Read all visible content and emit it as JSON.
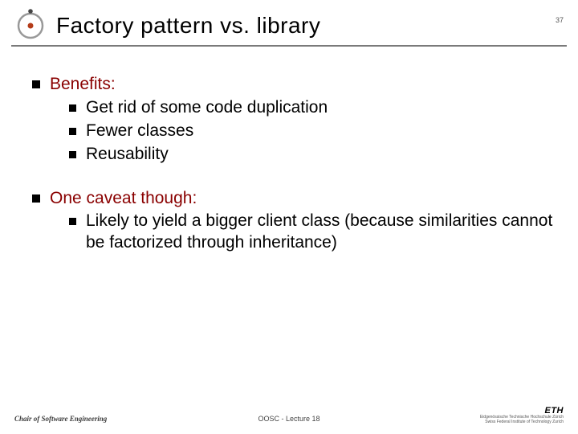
{
  "header": {
    "title": "Factory pattern vs. library",
    "page_number": "37"
  },
  "content": {
    "groups": [
      {
        "head": "Benefits:",
        "items": [
          "Get rid of some code duplication",
          "Fewer classes",
          "Reusability"
        ]
      },
      {
        "head": "One caveat though:",
        "items": [
          "Likely to yield a bigger client class (because similarities cannot be factorized through inheritance)"
        ]
      }
    ]
  },
  "footer": {
    "left": "Chair of Software Engineering",
    "center": "OOSC - Lecture 18",
    "right_brand": "ETH",
    "right_sub1": "Eidgenössische Technische Hochschule Zürich",
    "right_sub2": "Swiss Federal Institute of Technology Zurich"
  }
}
